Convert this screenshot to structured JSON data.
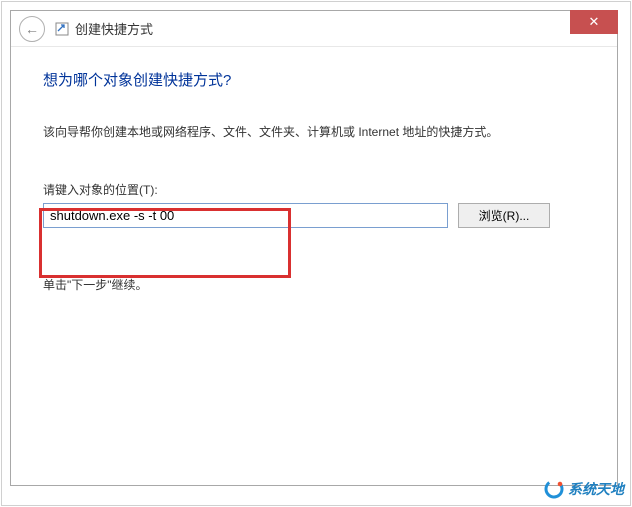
{
  "titlebar": {
    "title": "创建快捷方式"
  },
  "content": {
    "heading": "想为哪个对象创建快捷方式?",
    "description": "该向导帮你创建本地或网络程序、文件、文件夹、计算机或 Internet 地址的快捷方式。",
    "input_label": "请键入对象的位置(T):",
    "input_value": "shutdown.exe -s -t 00",
    "browse_label": "浏览(R)...",
    "continue_text": "单击\"下一步\"继续。"
  },
  "watermark": {
    "text": "系统天地"
  }
}
